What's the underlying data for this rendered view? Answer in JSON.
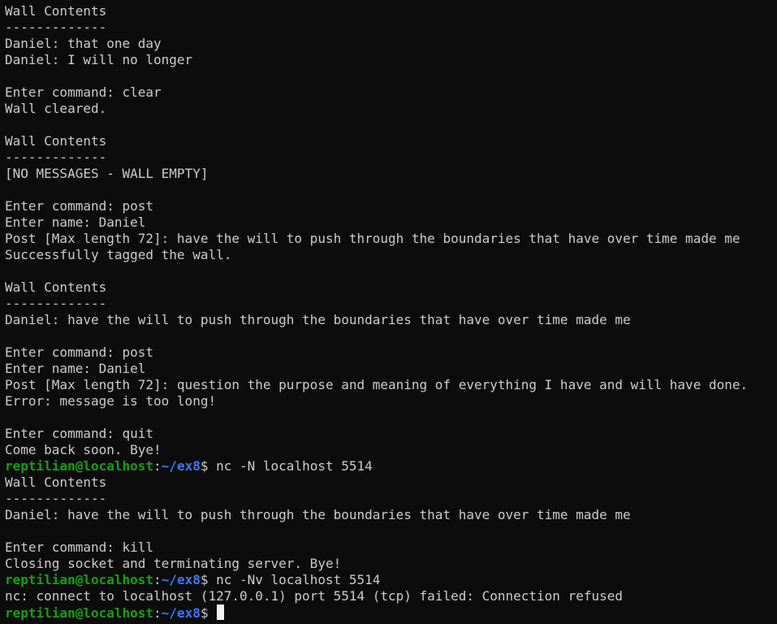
{
  "terminal": {
    "colors": {
      "background": "#0c0c0c",
      "foreground": "#cccccc",
      "prompt_user": "#13a10e",
      "prompt_path": "#3b78ff",
      "cursor": "#f2f2f2"
    },
    "prompt": {
      "user_host": "reptilian@localhost",
      "separator": ":",
      "path": "~/ex8",
      "symbol": "$ "
    },
    "lines": [
      {
        "type": "text",
        "text": "Wall Contents"
      },
      {
        "type": "text",
        "text": "-------------"
      },
      {
        "type": "text",
        "text": "Daniel: that one day"
      },
      {
        "type": "text",
        "text": "Daniel: I will no longer"
      },
      {
        "type": "text",
        "text": ""
      },
      {
        "type": "text",
        "text": "Enter command: clear"
      },
      {
        "type": "text",
        "text": "Wall cleared."
      },
      {
        "type": "text",
        "text": ""
      },
      {
        "type": "text",
        "text": "Wall Contents"
      },
      {
        "type": "text",
        "text": "-------------"
      },
      {
        "type": "text",
        "text": "[NO MESSAGES - WALL EMPTY]"
      },
      {
        "type": "text",
        "text": ""
      },
      {
        "type": "text",
        "text": "Enter command: post"
      },
      {
        "type": "text",
        "text": "Enter name: Daniel"
      },
      {
        "type": "text",
        "text": "Post [Max length 72]: have the will to push through the boundaries that have over time made me"
      },
      {
        "type": "text",
        "text": "Successfully tagged the wall."
      },
      {
        "type": "text",
        "text": ""
      },
      {
        "type": "text",
        "text": "Wall Contents"
      },
      {
        "type": "text",
        "text": "-------------"
      },
      {
        "type": "text",
        "text": "Daniel: have the will to push through the boundaries that have over time made me"
      },
      {
        "type": "text",
        "text": ""
      },
      {
        "type": "text",
        "text": "Enter command: post"
      },
      {
        "type": "text",
        "text": "Enter name: Daniel"
      },
      {
        "type": "text",
        "text": "Post [Max length 72]: question the purpose and meaning of everything I have and will have done."
      },
      {
        "type": "text",
        "text": "Error: message is too long!"
      },
      {
        "type": "text",
        "text": ""
      },
      {
        "type": "text",
        "text": "Enter command: quit"
      },
      {
        "type": "text",
        "text": "Come back soon. Bye!"
      },
      {
        "type": "prompt",
        "command": "nc -N localhost 5514"
      },
      {
        "type": "text",
        "text": "Wall Contents"
      },
      {
        "type": "text",
        "text": "-------------"
      },
      {
        "type": "text",
        "text": "Daniel: have the will to push through the boundaries that have over time made me"
      },
      {
        "type": "text",
        "text": ""
      },
      {
        "type": "text",
        "text": "Enter command: kill"
      },
      {
        "type": "text",
        "text": "Closing socket and terminating server. Bye!"
      },
      {
        "type": "prompt",
        "command": "nc -Nv localhost 5514"
      },
      {
        "type": "text",
        "text": "nc: connect to localhost (127.0.0.1) port 5514 (tcp) failed: Connection refused"
      },
      {
        "type": "prompt",
        "command": "",
        "cursor": true
      }
    ]
  }
}
